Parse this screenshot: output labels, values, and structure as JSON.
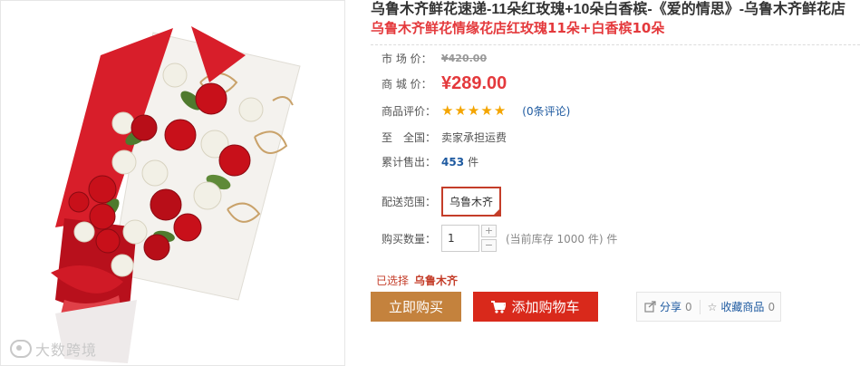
{
  "product": {
    "title": "乌鲁木齐鲜花速递-11朵红玫瑰+10朵白香槟-《爱的情思》-乌鲁木齐鲜花店",
    "subtitle": "乌鲁木齐鲜花情缘花店红玫瑰11朵+白香槟10朵"
  },
  "photo": {
    "watermark": "大数跨境",
    "colors": {
      "rose": "#c8101a",
      "white_rose": "#f2f0e6",
      "wrap_red": "#d81e2a",
      "leaf": "#4f7a2e",
      "swirl": "#c9a26a"
    }
  },
  "details": {
    "market_price_label": "市 场 价：",
    "market_price": "¥420.00",
    "mall_price_label": "商 城 价：",
    "mall_price": "¥289.00",
    "rating_label": "商品评价：",
    "rating_stars": 5,
    "review_link": "(0条评论)",
    "shipping_label": "至　全国：",
    "shipping_value": "卖家承担运费",
    "sold_label": "累计售出：",
    "sold_count": "453",
    "sold_unit": "件",
    "delivery_label": "配送范围：",
    "delivery_option": "乌鲁木齐",
    "qty_label": "购买数量：",
    "qty_value": "1",
    "qty_plus": "+",
    "qty_minus": "−",
    "stock_text": "(当前库存 1000 件) 件"
  },
  "selection": {
    "label": "已选择",
    "value": "乌鲁木齐"
  },
  "actions": {
    "buy_now": "立即购买",
    "add_to_cart": "添加购物车",
    "share_label": "分享",
    "share_count": "0",
    "favorite_label": "收藏商品",
    "favorite_count": "0"
  },
  "colors": {
    "accent_red": "#e4393c",
    "buy_button": "#c4823d",
    "cart_button": "#d9291b",
    "star": "#f4a500",
    "link": "#1e5aa0"
  }
}
